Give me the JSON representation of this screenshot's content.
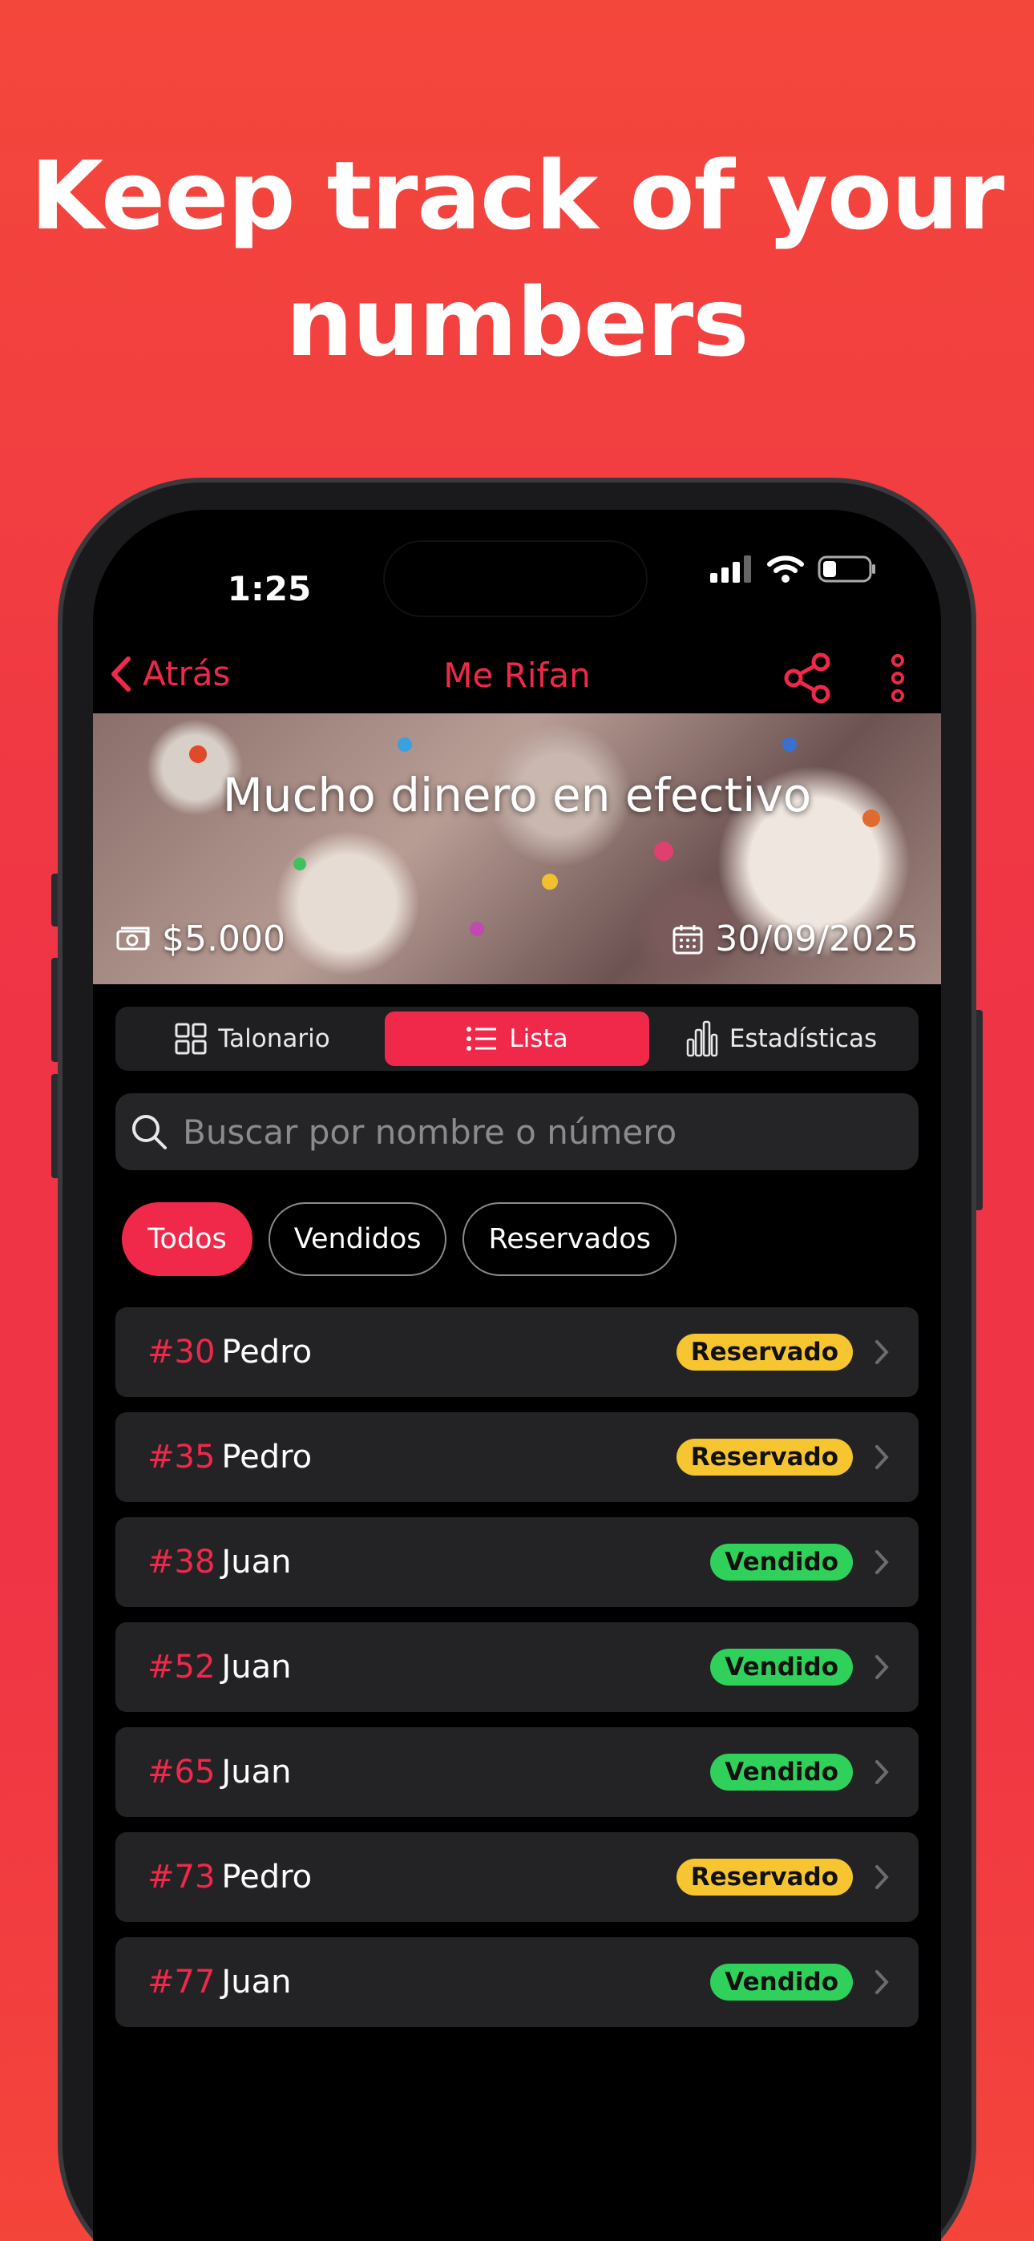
{
  "headline": {
    "line1": "Keep track of your",
    "line2": "numbers"
  },
  "status_bar": {
    "time": "1:25"
  },
  "navbar": {
    "back_label": "Atrás",
    "title": "Me Rifan"
  },
  "banner": {
    "title": "Mucho dinero en efectivo",
    "prize": "$5.000",
    "date": "30/09/2025"
  },
  "tabs": [
    {
      "label": "Talonario",
      "icon": "grid-icon",
      "active": false
    },
    {
      "label": "Lista",
      "icon": "list-icon",
      "active": true
    },
    {
      "label": "Estadísticas",
      "icon": "bar-chart-icon",
      "active": false
    }
  ],
  "search": {
    "placeholder": "Buscar por nombre o número"
  },
  "filters": [
    {
      "label": "Todos",
      "active": true
    },
    {
      "label": "Vendidos",
      "active": false
    },
    {
      "label": "Reservados",
      "active": false
    }
  ],
  "entries": [
    {
      "number": "#30",
      "name": "Pedro",
      "status": "Reservado"
    },
    {
      "number": "#35",
      "name": "Pedro",
      "status": "Reservado"
    },
    {
      "number": "#38",
      "name": "Juan",
      "status": "Vendido"
    },
    {
      "number": "#52",
      "name": "Juan",
      "status": "Vendido"
    },
    {
      "number": "#65",
      "name": "Juan",
      "status": "Vendido"
    },
    {
      "number": "#73",
      "name": "Pedro",
      "status": "Reservado"
    },
    {
      "number": "#77",
      "name": "Juan",
      "status": "Vendido"
    }
  ],
  "colors": {
    "accent": "#f0284a",
    "reserved": "#f6c530",
    "sold": "#2fd15b",
    "background": "#ef3446"
  }
}
